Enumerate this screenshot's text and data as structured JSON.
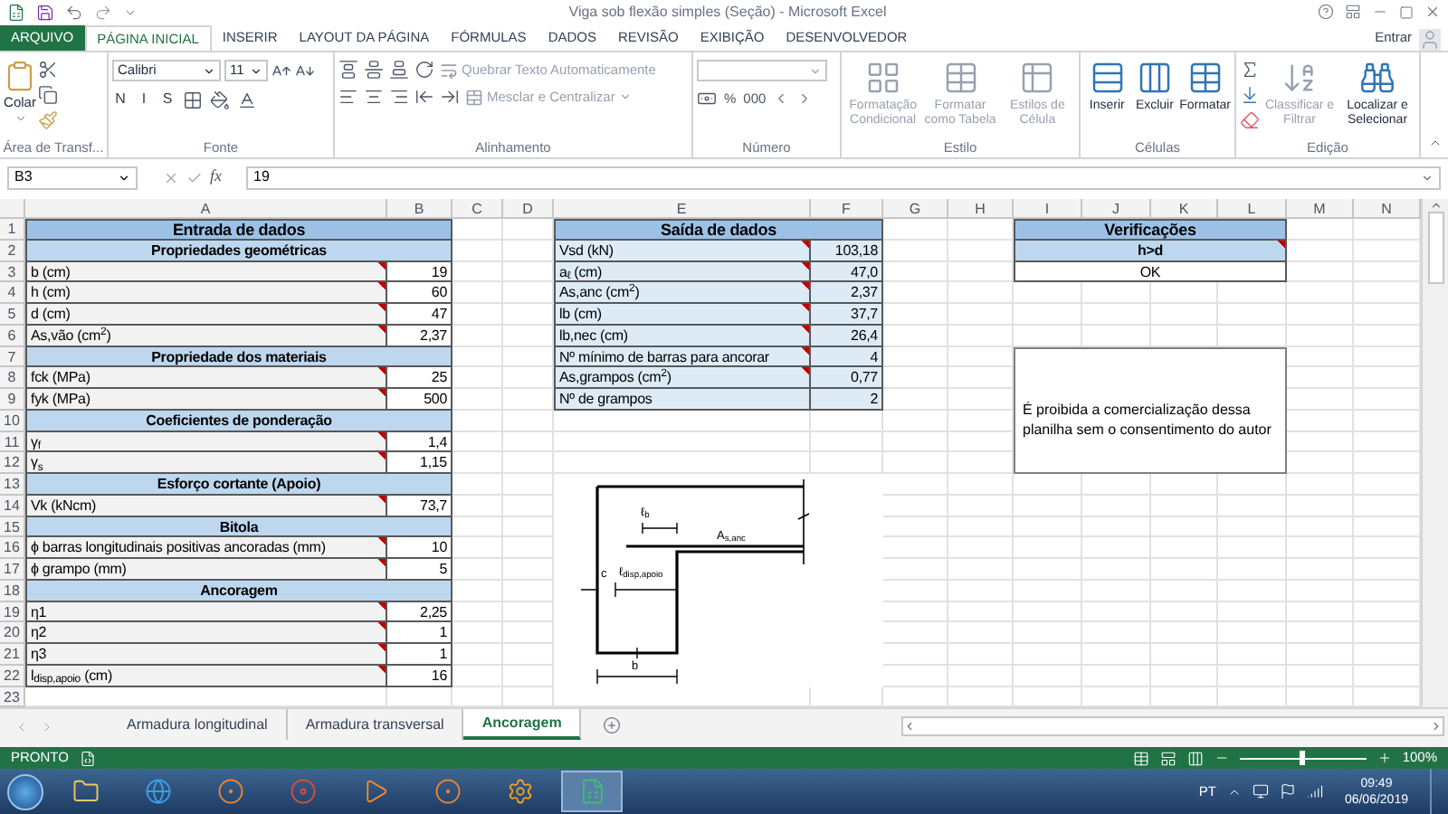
{
  "title_bar": {
    "title": "Viga sob flexão simples (Seção) - Microsoft Excel"
  },
  "ribbon_tabs": [
    {
      "label": "ARQUIVO",
      "kind": "file",
      "selected": false
    },
    {
      "label": "PÁGINA INICIAL",
      "kind": "tab",
      "selected": true
    },
    {
      "label": "INSERIR",
      "kind": "tab",
      "selected": false
    },
    {
      "label": "LAYOUT DA PÁGINA",
      "kind": "tab",
      "selected": false
    },
    {
      "label": "FÓRMULAS",
      "kind": "tab",
      "selected": false
    },
    {
      "label": "DADOS",
      "kind": "tab",
      "selected": false
    },
    {
      "label": "REVISÃO",
      "kind": "tab",
      "selected": false
    },
    {
      "label": "EXIBIÇÃO",
      "kind": "tab",
      "selected": false
    },
    {
      "label": "DESENVOLVEDOR",
      "kind": "tab",
      "selected": false
    }
  ],
  "account": {
    "label": "Entrar"
  },
  "ribbon": {
    "clipboard": {
      "paste": "Colar",
      "label": "Área de Transf..."
    },
    "font": {
      "name": "Calibri",
      "size": "11",
      "buttons": [
        "N",
        "I",
        "S"
      ],
      "label": "Fonte"
    },
    "alignment": {
      "wrap": {
        "label": "Quebrar Texto Automaticamente",
        "disabled": true
      },
      "merge": {
        "label": "Mesclar e Centralizar",
        "disabled": true
      },
      "label": "Alinhamento"
    },
    "number": {
      "buttons": [
        "%",
        "000"
      ],
      "label": "Número"
    },
    "styles": {
      "buttons": [
        {
          "label": "Formatação Condicional",
          "disabled": true
        },
        {
          "label": "Formatar como Tabela",
          "disabled": true
        },
        {
          "label": "Estilos de Célula",
          "disabled": true
        }
      ],
      "label": "Estilo"
    },
    "cells": {
      "buttons": [
        {
          "label": "Inserir",
          "disabled": false
        },
        {
          "label": "Excluir",
          "disabled": false
        },
        {
          "label": "Formatar",
          "disabled": false
        }
      ],
      "label": "Células"
    },
    "editing": {
      "buttons": [
        {
          "label": "Classificar e Filtrar",
          "disabled": true
        },
        {
          "label": "Localizar e Selecionar",
          "disabled": false
        }
      ],
      "label": "Edição"
    }
  },
  "formula_bar": {
    "name_box": "B3",
    "function_label": "fx",
    "value": "19"
  },
  "columns": [
    "A",
    "B",
    "C",
    "D",
    "E",
    "F",
    "G",
    "H",
    "I",
    "J",
    "K",
    "L",
    "M",
    "N"
  ],
  "rows": [
    "1",
    "2",
    "3",
    "4",
    "5",
    "6",
    "7",
    "8",
    "9",
    "10",
    "11",
    "12",
    "13",
    "14",
    "15",
    "16",
    "17",
    "18",
    "19",
    "20",
    "21",
    "22",
    "23"
  ],
  "input_table": {
    "title": "Entrada de dados",
    "sections": [
      {
        "heading": "Propriedades geométricas",
        "rows": [
          {
            "label": "b (cm)",
            "value": "19",
            "comment": true
          },
          {
            "label": "h (cm)",
            "value": "60",
            "comment": true
          },
          {
            "label": "d (cm)",
            "value": "47",
            "comment": true
          },
          {
            "label": "As,vão (cm$^{2}$)",
            "value": "2,37",
            "comment": true
          }
        ]
      },
      {
        "heading": "Propriedade dos materiais",
        "rows": [
          {
            "label": "fck (MPa)",
            "value": "25",
            "comment": true
          },
          {
            "label": "fyk (MPa)",
            "value": "500",
            "comment": true
          }
        ]
      },
      {
        "heading": "Coeficientes de ponderação",
        "rows": [
          {
            "label": "γ$_{f}$",
            "value": "1,4",
            "comment": true
          },
          {
            "label": "γ$_{s}$",
            "value": "1,15",
            "comment": true
          }
        ]
      },
      {
        "heading": "Esforço cortante (Apoio)",
        "rows": [
          {
            "label": "Vk (kNcm)",
            "value": "73,7",
            "comment": true
          }
        ]
      },
      {
        "heading": "Bitola",
        "rows": [
          {
            "label": "ϕ barras longitudinais positivas ancoradas (mm)",
            "value": "10",
            "comment": true
          },
          {
            "label": "ϕ grampo (mm)",
            "value": "5",
            "comment": true
          }
        ]
      },
      {
        "heading": "Ancoragem",
        "rows": [
          {
            "label": "η1",
            "value": "2,25",
            "comment": true
          },
          {
            "label": "η2",
            "value": "1",
            "comment": true
          },
          {
            "label": "η3",
            "value": "1",
            "comment": true
          },
          {
            "label": "l$_{disp,apoio}$ (cm)",
            "value": "16",
            "comment": true
          }
        ]
      }
    ]
  },
  "output_table": {
    "title": "Saída de dados",
    "rows": [
      {
        "label": "Vsd (kN)",
        "value": "103,18",
        "comment": true
      },
      {
        "label": "a$_{ℓ}$ (cm)",
        "value": "47,0",
        "comment": true
      },
      {
        "label": "As,anc (cm$^{2}$)",
        "value": "2,37",
        "comment": true
      },
      {
        "label": "lb (cm)",
        "value": "37,7",
        "comment": true
      },
      {
        "label": "lb,nec (cm)",
        "value": "26,4",
        "comment": true
      },
      {
        "label": "Nº mínimo de barras para ancorar",
        "value": "4",
        "comment": true
      },
      {
        "label": "As,grampos (cm$^{2}$)",
        "value": "0,77",
        "comment": true
      },
      {
        "label": "Nº de grampos",
        "value": "2",
        "comment": false
      }
    ]
  },
  "verification": {
    "title": "Verificações",
    "heading": "h>d",
    "heading_comment": true,
    "result": "OK"
  },
  "note": "É proibida a comercialização dessa planilha sem o consentimento do autor",
  "diagram": {
    "labels": [
      "ℓ$_{b}$",
      "A$_{s,anc}$",
      "c",
      "ℓ$_{disp,apoio}$",
      "b"
    ]
  },
  "sheet_tabs": [
    {
      "label": "Armadura longitudinal",
      "selected": false
    },
    {
      "label": "Armadura transversal",
      "selected": false
    },
    {
      "label": "Ancoragem",
      "selected": true
    }
  ],
  "status_bar": {
    "status": "PRONTO",
    "zoom": {
      "level": 0.5,
      "reading": "100%"
    }
  },
  "taskbar": {
    "language": "PT",
    "time": "09:49",
    "date": "06/06/2019"
  }
}
